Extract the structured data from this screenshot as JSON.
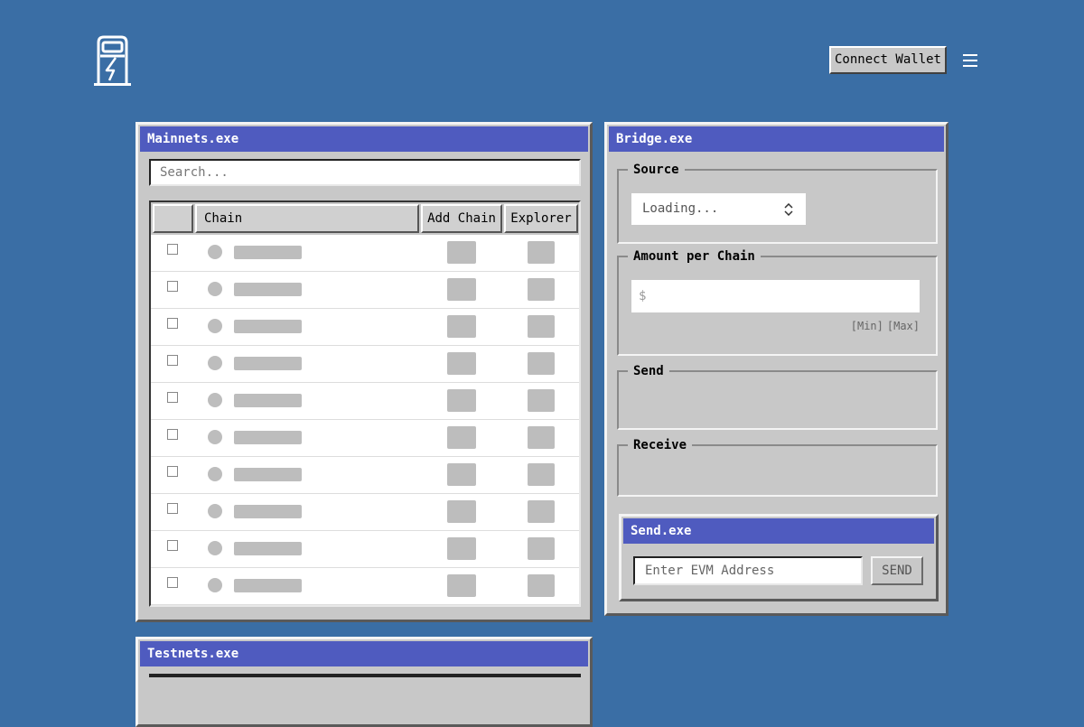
{
  "header": {
    "logo_icon": "fuel-pump-icon",
    "connect_label": "Connect Wallet",
    "menu_icon": "hamburger-menu-icon"
  },
  "mainnets": {
    "title": "Mainnets.exe",
    "search_placeholder": "Search...",
    "columns": [
      "",
      "Chain",
      "Add Chain",
      "Explorer"
    ],
    "rows": [
      "loading",
      "loading",
      "loading",
      "loading",
      "loading",
      "loading",
      "loading",
      "loading",
      "loading",
      "loading"
    ]
  },
  "bridge": {
    "title": "Bridge.exe",
    "source": {
      "label": "Source",
      "select_value": "Loading..."
    },
    "amount": {
      "label": "Amount per Chain",
      "prefix": "$",
      "min": "[Min]",
      "max": "[Max]"
    },
    "send": {
      "label": "Send"
    },
    "receive": {
      "label": "Receive"
    }
  },
  "send_window": {
    "title": "Send.exe",
    "address_placeholder": "Enter EVM Address",
    "send_label": "SEND"
  },
  "testnets": {
    "title": "Testnets.exe"
  },
  "colors": {
    "desktop": "#3a6ea5",
    "titlebar": "#4f5bbf",
    "window": "#c8c8c8"
  }
}
